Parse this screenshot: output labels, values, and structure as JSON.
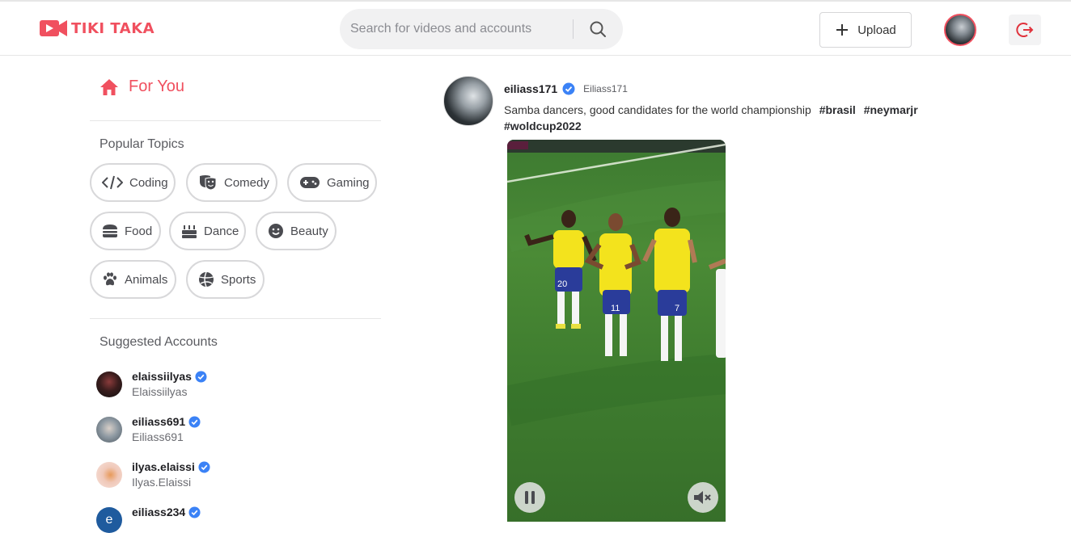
{
  "brand": {
    "name": "TIKI TAKA",
    "accent": "#f0505f"
  },
  "search": {
    "placeholder": "Search for videos and accounts"
  },
  "header": {
    "upload_label": "Upload"
  },
  "sidebar": {
    "for_you_label": "For You",
    "popular_topics_title": "Popular Topics",
    "topics": [
      {
        "label": "Coding",
        "icon": "code-icon"
      },
      {
        "label": "Comedy",
        "icon": "masks-icon"
      },
      {
        "label": "Gaming",
        "icon": "gamepad-icon"
      },
      {
        "label": "Food",
        "icon": "burger-icon"
      },
      {
        "label": "Dance",
        "icon": "cake-icon"
      },
      {
        "label": "Beauty",
        "icon": "smile-icon"
      },
      {
        "label": "Animals",
        "icon": "paw-icon"
      },
      {
        "label": "Sports",
        "icon": "ball-icon"
      }
    ],
    "suggested_title": "Suggested Accounts",
    "accounts": [
      {
        "username": "elaissiilyas",
        "display": "Elaissiilyas"
      },
      {
        "username": "eiliass691",
        "display": "Eiliass691"
      },
      {
        "username": "ilyas.elaissi",
        "display": "Ilyas.Elaissi"
      },
      {
        "username": "eiliass234",
        "display": ""
      }
    ]
  },
  "post": {
    "username": "eiliass171",
    "handle": "Eiliass171",
    "caption": "Samba dancers, good candidates for the world championship",
    "hashtags": [
      "#brasil",
      "#neymarjr",
      "#woldcup2022"
    ]
  },
  "colors": {
    "verified": "#3b82f6",
    "logout": "#e0323c"
  }
}
